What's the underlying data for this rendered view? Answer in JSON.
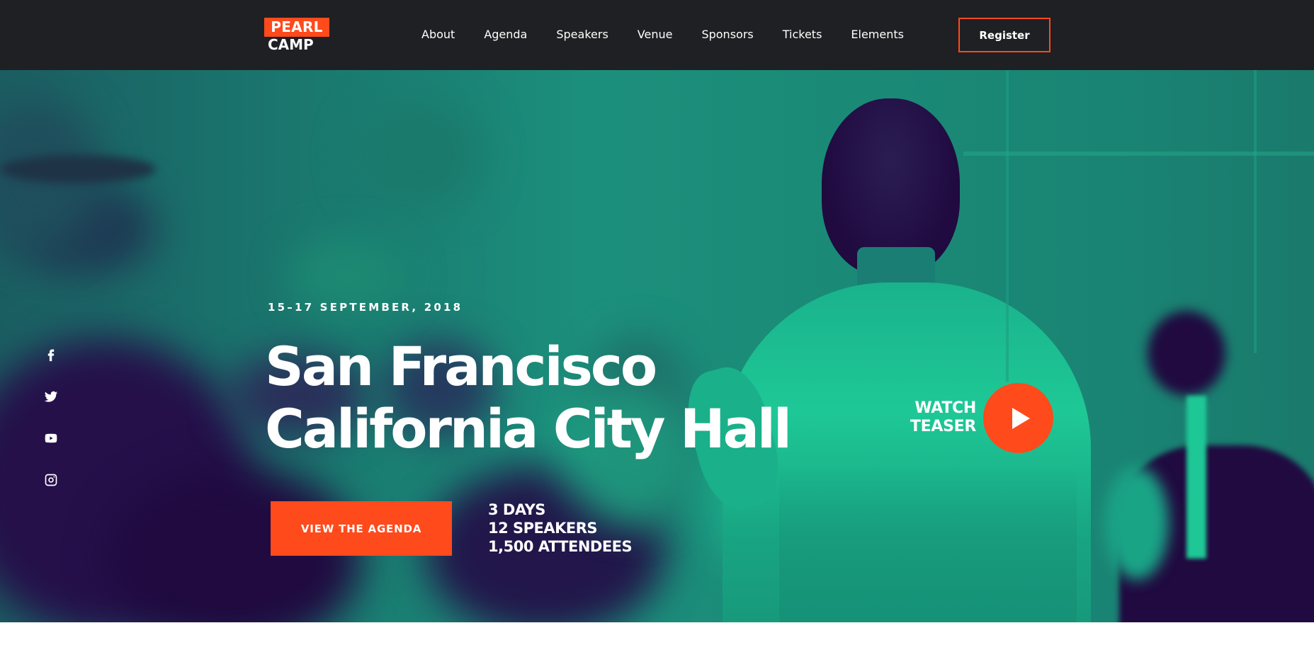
{
  "header": {
    "logo": {
      "line1": "PEARL",
      "line2": "CAMP"
    },
    "nav": [
      {
        "label": "About"
      },
      {
        "label": "Agenda"
      },
      {
        "label": "Speakers"
      },
      {
        "label": "Venue"
      },
      {
        "label": "Sponsors"
      },
      {
        "label": "Tickets"
      },
      {
        "label": "Elements"
      }
    ],
    "register_label": "Register"
  },
  "hero": {
    "date": "15–17 SEPTEMBER, 2018",
    "title_line1": "San Francisco",
    "title_line2": "California City Hall",
    "cta_label": "VIEW THE AGENDA",
    "stats": [
      "3 DAYS",
      "12 SPEAKERS",
      "1,500 ATTENDEES"
    ],
    "watch_line1": "WATCH",
    "watch_line2": "TEASER",
    "social": [
      {
        "icon": "facebook-icon"
      },
      {
        "icon": "twitter-icon"
      },
      {
        "icon": "youtube-icon"
      },
      {
        "icon": "instagram-icon"
      }
    ]
  },
  "colors": {
    "accent": "#ff4a1c",
    "header_bg": "#1f2023",
    "duotone_light": "#1ec896",
    "duotone_dark": "#200a40"
  }
}
